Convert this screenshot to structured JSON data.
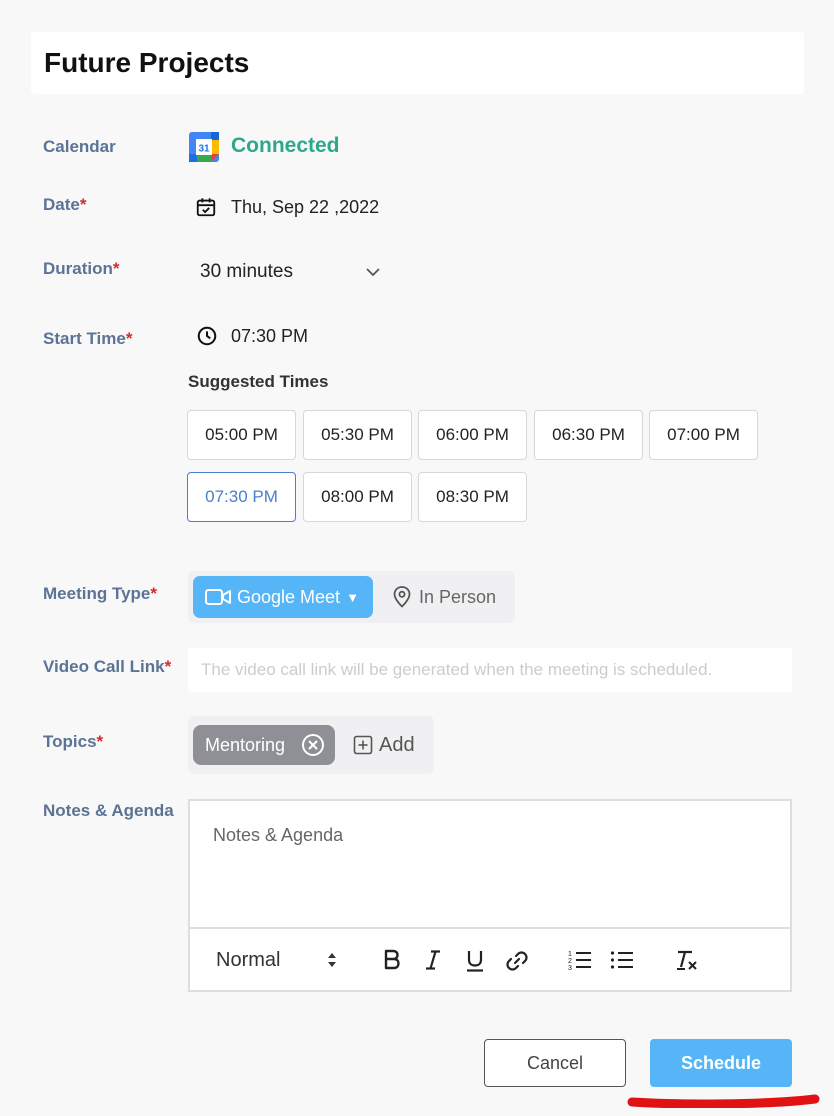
{
  "header": {
    "title": "Future Projects"
  },
  "labels": {
    "calendar": "Calendar",
    "date": "Date",
    "duration": "Duration",
    "start_time": "Start Time",
    "meeting_type": "Meeting Type",
    "video_call_link": "Video Call Link",
    "topics": "Topics",
    "notes_agenda": "Notes & Agenda",
    "required_mark": "*"
  },
  "calendar": {
    "icon_text": "31",
    "status": "Connected",
    "status_color": "#2ea88a"
  },
  "date": {
    "value": "Thu, Sep 22 ,2022",
    "icon": "calendar-check-icon"
  },
  "duration": {
    "value": "30 minutes",
    "icon": "chevron-down-icon"
  },
  "start_time": {
    "value": "07:30 PM",
    "icon": "clock-icon"
  },
  "suggested": {
    "title": "Suggested Times",
    "times": [
      "05:00 PM",
      "05:30 PM",
      "06:00 PM",
      "06:30 PM",
      "07:00 PM",
      "07:30 PM",
      "08:00 PM",
      "08:30 PM"
    ],
    "selected": "07:30 PM"
  },
  "meeting_type": {
    "google_meet": "Google Meet",
    "caret": "▼",
    "in_person": "In Person",
    "selected": "Google Meet",
    "accent": "#56b5f7"
  },
  "video_call": {
    "placeholder": "The video call link will be generated when the meeting is scheduled."
  },
  "topics": {
    "chips": [
      "Mentoring"
    ],
    "add_label": "Add"
  },
  "notes": {
    "placeholder": "Notes & Agenda",
    "format_select": "Normal",
    "toolbar_icons": [
      "bold-icon",
      "italic-icon",
      "underline-icon",
      "link-icon",
      "ordered-list-icon",
      "bullet-list-icon",
      "clear-format-icon"
    ]
  },
  "actions": {
    "cancel": "Cancel",
    "schedule": "Schedule"
  },
  "annotation": {
    "color": "#e01212"
  }
}
